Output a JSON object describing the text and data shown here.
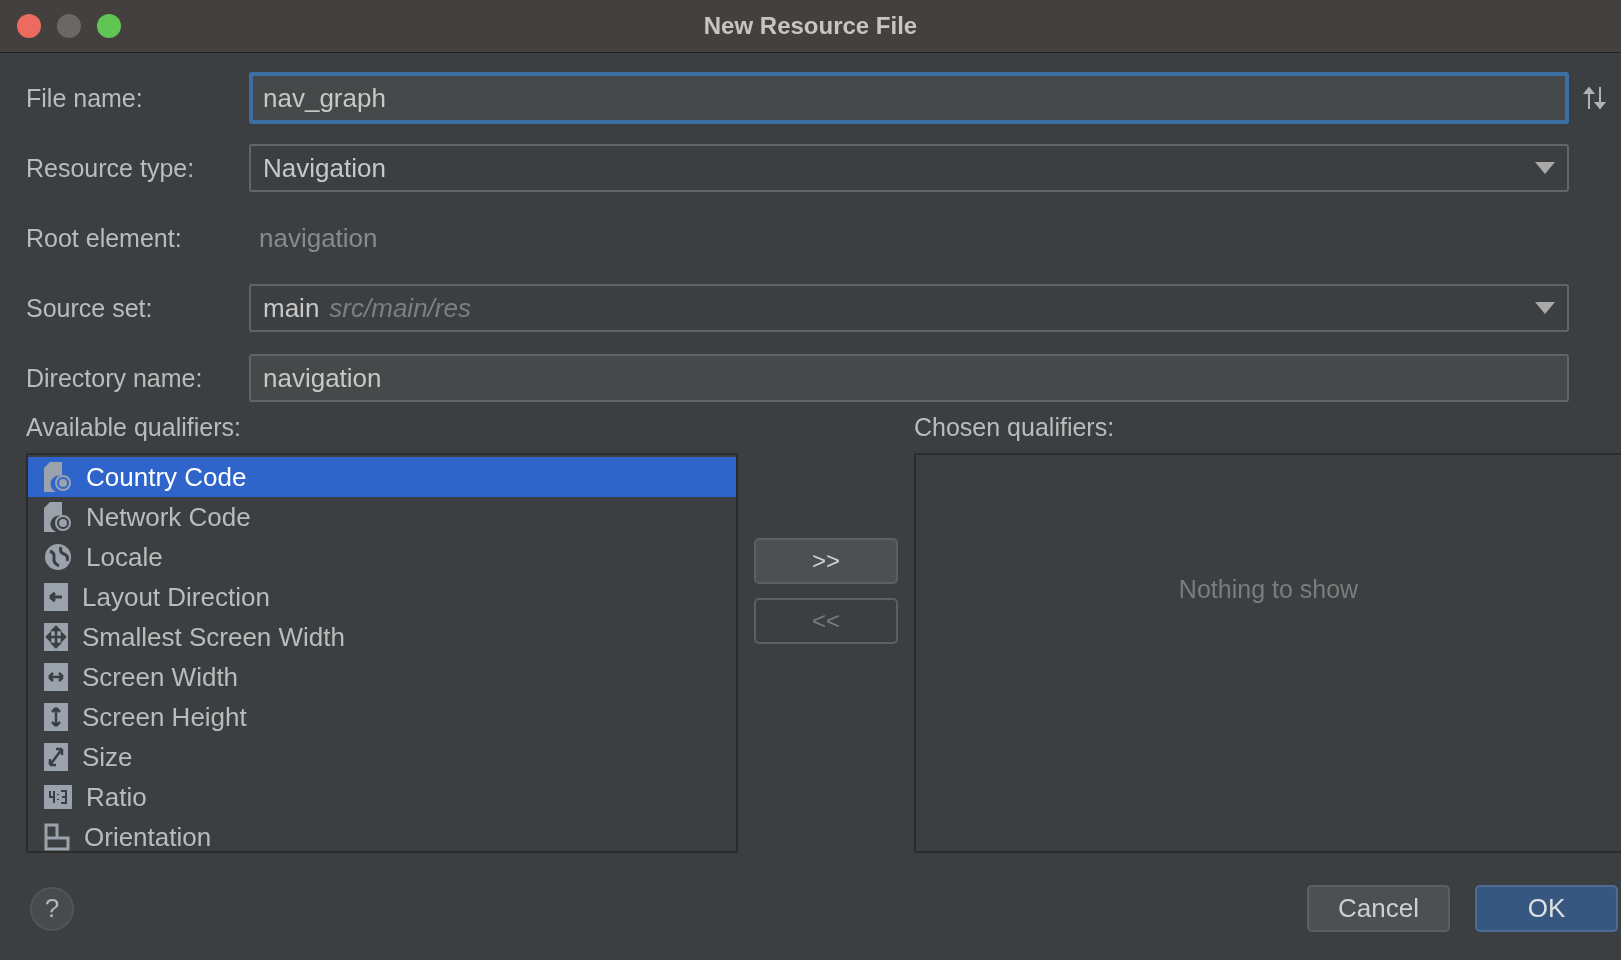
{
  "window": {
    "title": "New Resource File"
  },
  "form": [
    {
      "kind": "text",
      "label": "File name:",
      "value": "nav_graph",
      "focused": true
    },
    {
      "kind": "combo",
      "label": "Resource type:",
      "value": "Navigation"
    },
    {
      "kind": "static",
      "label": "Root element:",
      "value": "navigation"
    },
    {
      "kind": "combo",
      "label": "Source set:",
      "value": "main",
      "detail": "src/main/res"
    },
    {
      "kind": "text",
      "label": "Directory name:",
      "value": "navigation",
      "focused": false
    }
  ],
  "available": {
    "label": "Available qualifiers:",
    "items": [
      {
        "label": "Country Code",
        "kind": "country",
        "selected": true
      },
      {
        "label": "Network Code",
        "kind": "network",
        "selected": false
      },
      {
        "label": "Locale",
        "kind": "locale",
        "selected": false
      },
      {
        "label": "Layout Direction",
        "kind": "direction",
        "selected": false
      },
      {
        "label": "Smallest Screen Width",
        "kind": "smallest",
        "selected": false
      },
      {
        "label": "Screen Width",
        "kind": "width",
        "selected": false
      },
      {
        "label": "Screen Height",
        "kind": "height",
        "selected": false
      },
      {
        "label": "Size",
        "kind": "size",
        "selected": false
      },
      {
        "label": "Ratio",
        "kind": "ratio",
        "selected": false
      },
      {
        "label": "Orientation",
        "kind": "orientation",
        "selected": false
      }
    ]
  },
  "transfer": [
    {
      "label": ">>",
      "disabled": false
    },
    {
      "label": "<<",
      "disabled": true
    }
  ],
  "chosen": {
    "label": "Chosen qualifiers:",
    "empty_text": "Nothing to show"
  },
  "footer": {
    "help": "?",
    "buttons": [
      {
        "label": "Cancel",
        "default": false
      },
      {
        "label": "OK",
        "default": true
      }
    ]
  }
}
